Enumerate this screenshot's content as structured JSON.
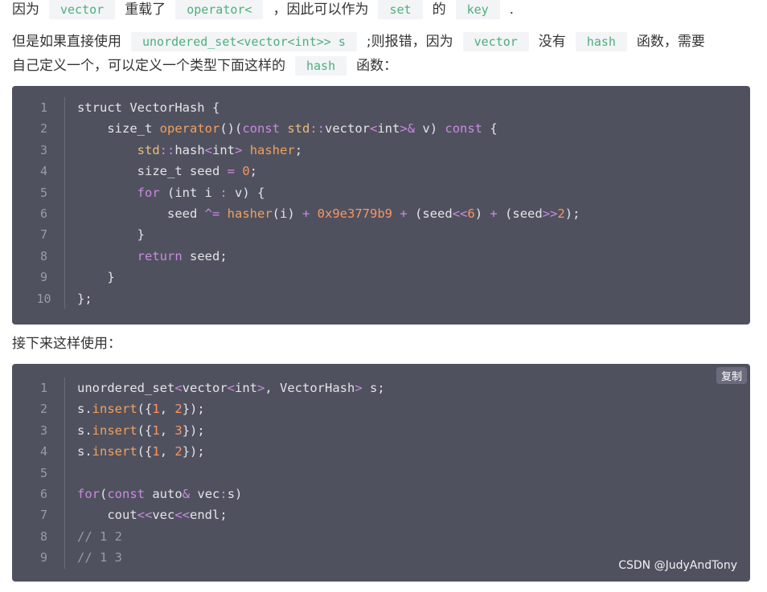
{
  "paragraph1": {
    "t1": "因为",
    "c1": "vector",
    "t2": "重载了",
    "c2": "operator<",
    "t3": "，因此可以作为",
    "c3": "set",
    "t4": "的",
    "c4": "key",
    "t5": "."
  },
  "paragraph2": {
    "t1": "但是如果直接使用",
    "c1": "unordered_set<vector<int>> s",
    "t2": ";则报错，因为",
    "c2": "vector",
    "t3": "没有",
    "c3": "hash",
    "t4": "函数，需要",
    "t5": "自己定义一个，可以定义一个类型下面这样的",
    "c4": "hash",
    "t6": "函数："
  },
  "paragraph3": {
    "text": "接下来这样使用："
  },
  "code1": {
    "line_numbers": [
      "1",
      "2",
      "3",
      "4",
      "5",
      "6",
      "7",
      "8",
      "9",
      "10"
    ],
    "lines": [
      "struct VectorHash {",
      "    size_t operator()(const std::vector<int>& v) const {",
      "        std::hash<int> hasher;",
      "        size_t seed = 0;",
      "        for (int i : v) {",
      "            seed ^= hasher(i) + 0x9e3779b9 + (seed<<6) + (seed>>2);",
      "        }",
      "        return seed;",
      "    }",
      "};"
    ]
  },
  "code2": {
    "copy_label": "复制",
    "line_numbers": [
      "1",
      "2",
      "3",
      "4",
      "5",
      "6",
      "7",
      "8",
      "9"
    ],
    "lines": [
      "unordered_set<vector<int>, VectorHash> s;",
      "s.insert({1, 2});",
      "s.insert({1, 3});",
      "s.insert({1, 2});",
      "",
      "for(const auto& vec:s)",
      "    cout<<vec<<endl;",
      "// 1 2",
      "// 1 3"
    ]
  },
  "watermark": "CSDN @JudyAndTony",
  "colors": {
    "inline_code": "#4daf7c",
    "code_bg": "#50515f",
    "keyword": "#c98bdf",
    "number": "#f69665"
  }
}
